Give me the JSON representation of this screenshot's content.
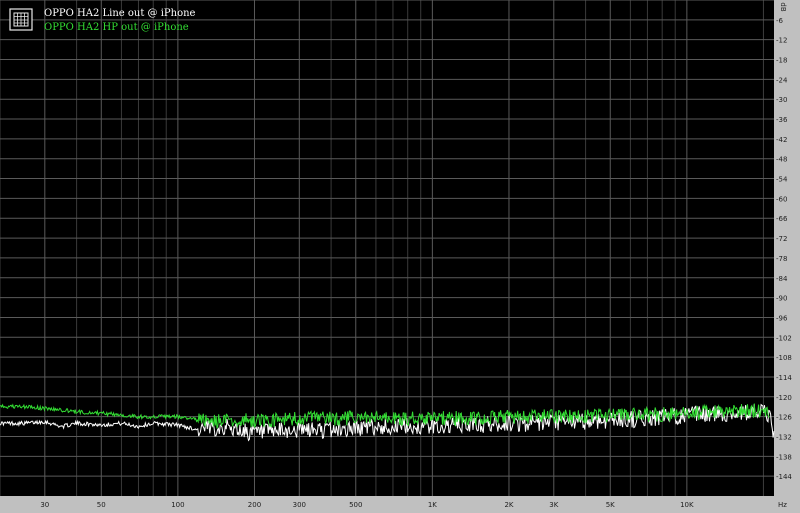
{
  "chart_data": {
    "type": "line",
    "title": "",
    "xlabel": "",
    "ylabel": "dB",
    "x_unit": "Hz",
    "x_scale": "log",
    "xlim": [
      20,
      22000
    ],
    "ylim": [
      -150,
      0
    ],
    "grid": true,
    "legend_position": "top-left",
    "background_color": "#000000",
    "grid_color": "#5a5a5a",
    "x_ticks": [
      {
        "value": 30,
        "label": "30"
      },
      {
        "value": 50,
        "label": "50"
      },
      {
        "value": 100,
        "label": "100"
      },
      {
        "value": 200,
        "label": "200"
      },
      {
        "value": 300,
        "label": "300"
      },
      {
        "value": 500,
        "label": "500"
      },
      {
        "value": 1000,
        "label": "1K"
      },
      {
        "value": 2000,
        "label": "2K"
      },
      {
        "value": 3000,
        "label": "3K"
      },
      {
        "value": 5000,
        "label": "5K"
      },
      {
        "value": 10000,
        "label": "10K"
      }
    ],
    "y_ticks": [
      0,
      -6,
      -12,
      -18,
      -24,
      -30,
      -36,
      -42,
      -48,
      -54,
      -60,
      -66,
      -72,
      -78,
      -84,
      -90,
      -96,
      -102,
      -108,
      -114,
      -120,
      -126,
      -132,
      -138,
      -144
    ],
    "series": [
      {
        "name": "OPPO HA2 Line out @ iPhone",
        "color": "#ffffff",
        "x": [
          20,
          25,
          30,
          35,
          40,
          50,
          60,
          70,
          80,
          100,
          120,
          150,
          200,
          250,
          300,
          400,
          500,
          700,
          1000,
          1500,
          2000,
          3000,
          5000,
          7000,
          10000,
          15000,
          20000,
          21000,
          22000
        ],
        "y": [
          -128,
          -128,
          -127.5,
          -129,
          -128,
          -128.5,
          -128,
          -129,
          -128,
          -128.5,
          -130,
          -129,
          -131,
          -130.5,
          -130,
          -130,
          -129.5,
          -129,
          -129,
          -128.5,
          -128,
          -128,
          -127,
          -126.5,
          -125.5,
          -125,
          -124.5,
          -126,
          -131
        ]
      },
      {
        "name": "OPPO HA2 HP out @ iPhone",
        "color": "#33dd33",
        "x": [
          20,
          25,
          30,
          35,
          40,
          50,
          60,
          70,
          80,
          100,
          120,
          150,
          200,
          250,
          300,
          400,
          500,
          700,
          1000,
          1500,
          2000,
          3000,
          5000,
          7000,
          10000,
          15000,
          20000,
          21000
        ],
        "y": [
          -123,
          -123,
          -123.5,
          -124,
          -124.5,
          -125,
          -125.5,
          -126,
          -126,
          -126,
          -127,
          -127.5,
          -127,
          -127,
          -126.5,
          -126.5,
          -126.5,
          -126.5,
          -126.5,
          -126.5,
          -126,
          -126,
          -125.5,
          -125.5,
          -125,
          -124.5,
          -124,
          -124.5
        ]
      }
    ]
  }
}
